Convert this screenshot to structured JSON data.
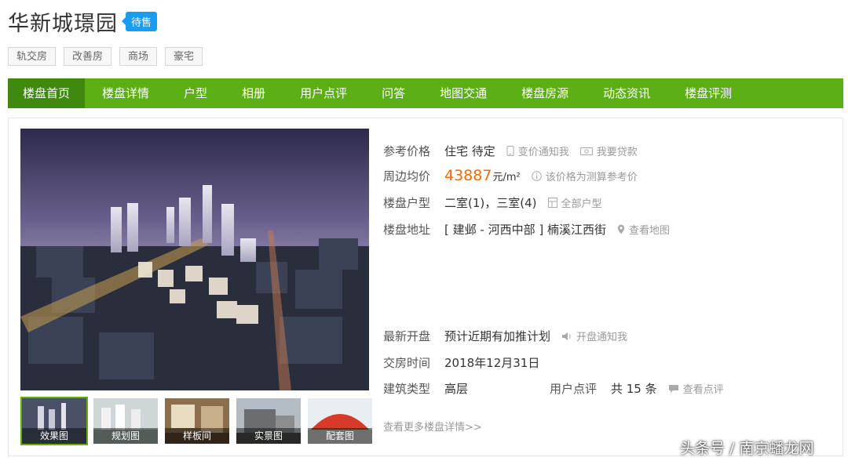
{
  "project": {
    "name": "华新城璟园",
    "status": "待售"
  },
  "tags": [
    "轨交房",
    "改善房",
    "商场",
    "豪宅"
  ],
  "nav": [
    "楼盘首页",
    "楼盘详情",
    "户型",
    "相册",
    "用户点评",
    "问答",
    "地图交通",
    "楼盘房源",
    "动态资讯",
    "楼盘评测"
  ],
  "gallery": {
    "thumbs": [
      "效果图",
      "规划图",
      "样板间",
      "实景图",
      "配套图"
    ]
  },
  "info": {
    "ref_price": {
      "label": "参考价格",
      "value": "住宅 待定",
      "notify": "变价通知我",
      "loan": "我要贷款"
    },
    "avg_price": {
      "label": "周边均价",
      "value": "43887",
      "unit": "元/m²",
      "note": "该价格为测算参考价"
    },
    "layout": {
      "label": "楼盘户型",
      "value": "二室(1)，三室(4)",
      "all": "全部户型"
    },
    "address": {
      "label": "楼盘地址",
      "value": "[ 建邺 - 河西中部 ] 楠溪江西街",
      "map": "查看地图"
    },
    "opening": {
      "label": "最新开盘",
      "value": "预计近期有加推计划",
      "notify": "开盘通知我"
    },
    "delivery": {
      "label": "交房时间",
      "value": "2018年12月31日"
    },
    "building": {
      "label": "建筑类型",
      "value": "高层"
    },
    "reviews": {
      "label": "用户点评",
      "value": "共 15 条",
      "link": "查看点评"
    },
    "more": "查看更多楼盘详情>>"
  },
  "watermark": "头条号 / 南京蟠龙网",
  "colors": {
    "nav_green": "#5cb016",
    "nav_active": "#3f8a0e",
    "badge_blue": "#1a9cf0",
    "price_orange": "#f56a00"
  },
  "icons": [
    "phone-icon",
    "loan-icon",
    "info-icon",
    "floorplan-icon",
    "map-pin-icon",
    "speaker-icon",
    "comment-icon"
  ]
}
